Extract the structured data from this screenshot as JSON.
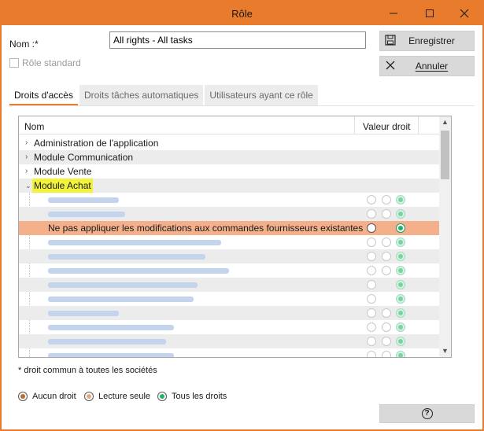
{
  "window": {
    "title": "Rôle",
    "accent": "#e87b2c"
  },
  "form": {
    "name_label": "Nom :*",
    "name_value": "All rights - All tasks",
    "standard_label": "Rôle standard"
  },
  "actions": {
    "save_label": "Enregistrer",
    "cancel_label": "Annuler"
  },
  "tabs": [
    {
      "label": "Droits d'accès",
      "active": true
    },
    {
      "label": "Droits tâches automatiques",
      "active": false
    },
    {
      "label": "Utilisateurs ayant ce rôle",
      "active": false
    }
  ],
  "grid": {
    "col_name": "Nom",
    "col_value": "Valeur droit",
    "groups": [
      {
        "label": "Administration de l'application"
      },
      {
        "label": "Module Communication"
      },
      {
        "label": "Module Vente"
      },
      {
        "label": "Module Achat"
      }
    ],
    "selected_row": "Ne pas appliquer les modifications aux commandes fournisseurs existantes"
  },
  "footnote": "* droit commun à toutes les sociétés",
  "legend": [
    {
      "label": "Aucun droit",
      "color": "#b46c30"
    },
    {
      "label": "Lecture seule",
      "color": "#e2a985"
    },
    {
      "label": "Tous les droits",
      "color": "#1fb36a"
    }
  ]
}
